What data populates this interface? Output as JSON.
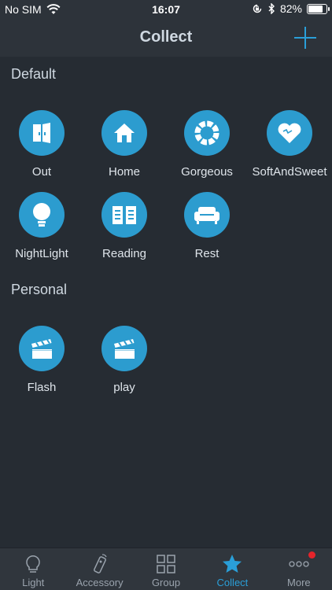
{
  "status_bar": {
    "carrier": "No SIM",
    "time": "16:07",
    "battery_percent": "82%",
    "battery_level": 0.82,
    "icons": [
      "wifi-icon",
      "orientation-lock-icon",
      "bluetooth-icon",
      "battery-icon"
    ]
  },
  "nav": {
    "title": "Collect",
    "add_icon": "plus-icon"
  },
  "sections": {
    "default": {
      "title": "Default",
      "items": [
        {
          "label": "Out",
          "icon": "door-icon"
        },
        {
          "label": "Home",
          "icon": "house-icon"
        },
        {
          "label": "Gorgeous",
          "icon": "ring-icon"
        },
        {
          "label": "SoftAndSweet",
          "icon": "heart-icon"
        },
        {
          "label": "NightLight",
          "icon": "bulb-icon"
        },
        {
          "label": "Reading",
          "icon": "book-icon"
        },
        {
          "label": "Rest",
          "icon": "sofa-icon"
        }
      ]
    },
    "personal": {
      "title": "Personal",
      "items": [
        {
          "label": "Flash",
          "icon": "clapperboard-icon"
        },
        {
          "label": "play",
          "icon": "clapperboard-icon"
        }
      ]
    }
  },
  "tab_bar": {
    "tabs": [
      {
        "label": "Light",
        "icon": "lightbulb-icon"
      },
      {
        "label": "Accessory",
        "icon": "remote-icon"
      },
      {
        "label": "Group",
        "icon": "grid-icon"
      },
      {
        "label": "Collect",
        "icon": "star-icon",
        "active": true
      },
      {
        "label": "More",
        "icon": "more-dots-icon",
        "badge": true
      }
    ]
  },
  "colors": {
    "accent": "#2a9fd8",
    "tile_background": "#2c9ccf",
    "page_background": "#262c33",
    "bar_background": "#2d333a",
    "badge": "#e5242b"
  }
}
